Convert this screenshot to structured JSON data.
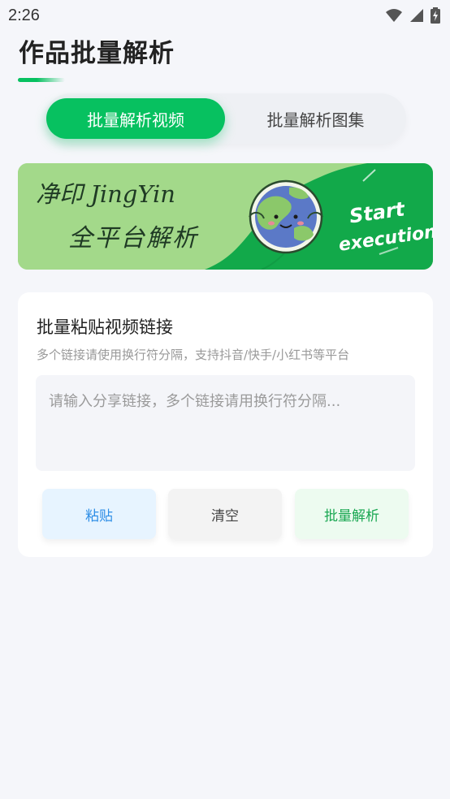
{
  "status_bar": {
    "time": "2:26"
  },
  "header": {
    "title": "作品批量解析"
  },
  "tabs": [
    {
      "label": "批量解析视频",
      "active": true
    },
    {
      "label": "批量解析图集",
      "active": false
    }
  ],
  "banner": {
    "line1": "净印 JingYin",
    "line2": "全平台解析",
    "cta_line1": "Start",
    "cta_line2": "execution"
  },
  "card": {
    "title": "批量粘贴视频链接",
    "subtitle": "多个链接请使用换行符分隔，支持抖音/快手/小红书等平台",
    "input": {
      "value": "",
      "placeholder": "请输入分享链接，多个链接请用换行符分隔..."
    },
    "buttons": {
      "paste": "粘贴",
      "clear": "清空",
      "parse": "批量解析"
    }
  },
  "colors": {
    "accent": "#07c160",
    "banner_light": "#a3d98a",
    "banner_dark": "#12a94a",
    "paste": "#2e8ee6"
  }
}
